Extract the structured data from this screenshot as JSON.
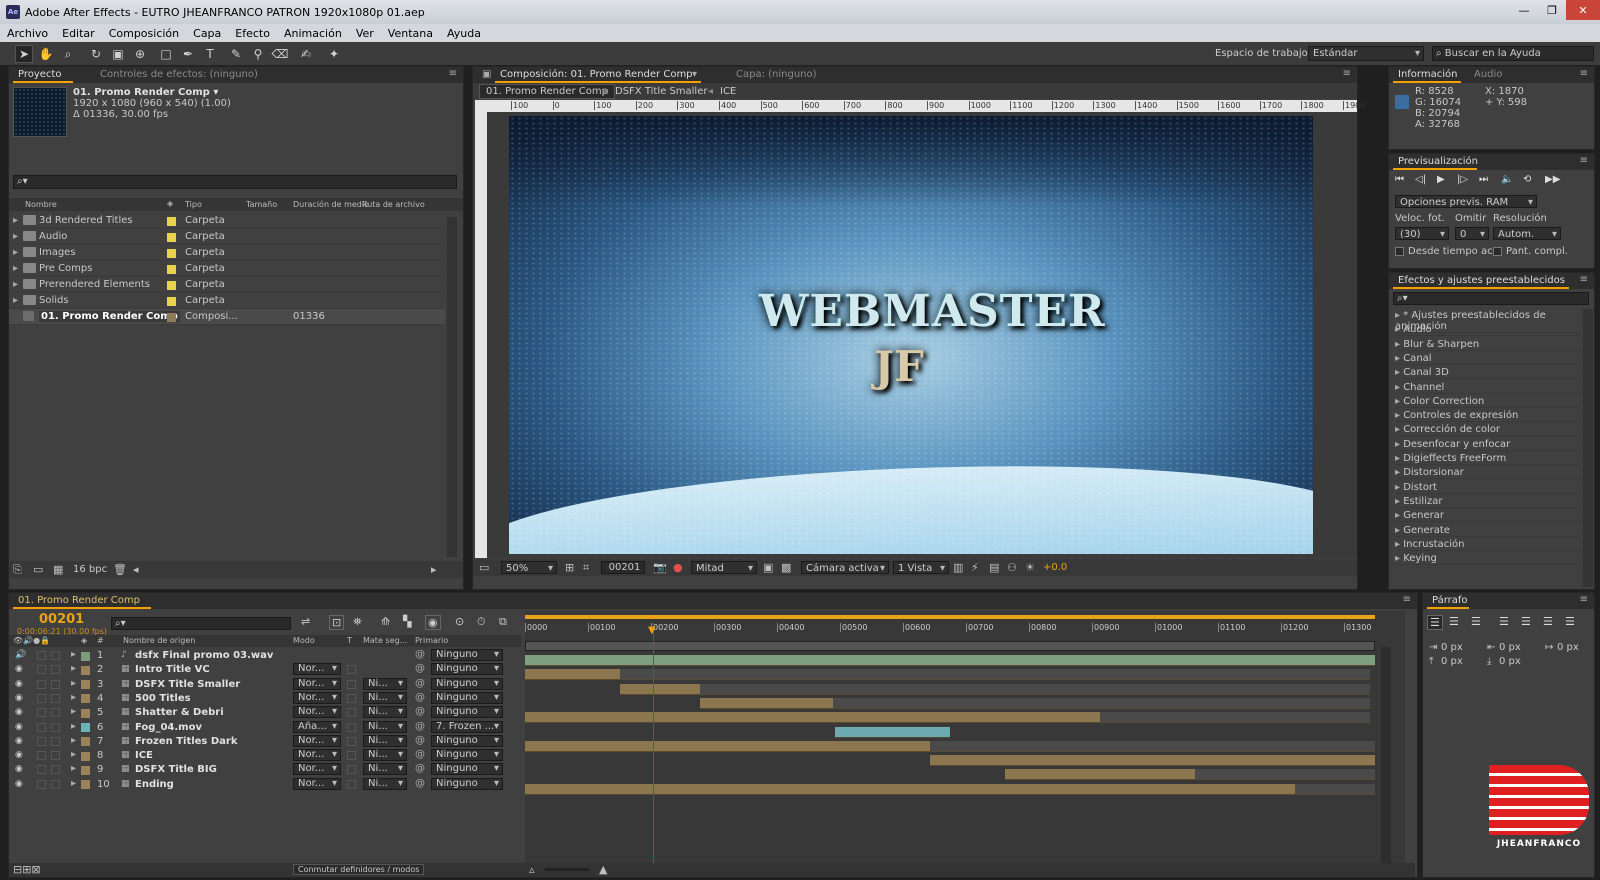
{
  "window": {
    "title": "Adobe After Effects - EUTRO JHEANFRANCO PATRON 1920x1080p 01.aep",
    "app_icon": "Ae"
  },
  "menu": [
    "Archivo",
    "Editar",
    "Composición",
    "Capa",
    "Efecto",
    "Animación",
    "Ver",
    "Ventana",
    "Ayuda"
  ],
  "toolbar": {
    "workspace_label": "Espacio de trabajo:",
    "workspace_value": "Estándar",
    "help_placeholder": "Buscar en la Ayuda"
  },
  "project": {
    "tab": "Proyecto",
    "tab2": "Controles de efectos: (ninguno)",
    "comp_name": "01. Promo Render Comp ▾",
    "comp_res": "1920 x 1080  (960 x 540) (1.00)",
    "comp_dur": "Δ 01336, 30.00 fps",
    "columns": [
      "Nombre",
      "Tipo",
      "Tamaño",
      "Duración de medio",
      "Ruta de archivo"
    ],
    "items": [
      {
        "name": "3d Rendered Titles",
        "type": "Carpeta",
        "dur": ""
      },
      {
        "name": "Audio",
        "type": "Carpeta",
        "dur": ""
      },
      {
        "name": "Images",
        "type": "Carpeta",
        "dur": ""
      },
      {
        "name": "Pre Comps",
        "type": "Carpeta",
        "dur": ""
      },
      {
        "name": "Prerendered Elements",
        "type": "Carpeta",
        "dur": ""
      },
      {
        "name": "Solids",
        "type": "Carpeta",
        "dur": ""
      },
      {
        "name": "01. Promo Render Comp",
        "type": "Composi...",
        "dur": "01336"
      }
    ],
    "bpc": "16 bpc"
  },
  "comp": {
    "tab": "Composición: 01. Promo Render Comp",
    "tab2": "Capa: (ninguno)",
    "crumbs": [
      "01. Promo Render Comp",
      "DSFX Title Smaller",
      "ICE"
    ],
    "ruler": [
      "100",
      "0",
      "100",
      "200",
      "300",
      "400",
      "500",
      "600",
      "700",
      "800",
      "900",
      "1000",
      "1100",
      "1200",
      "1300",
      "1400",
      "1500",
      "1600",
      "1700",
      "1800",
      "1900"
    ],
    "title_line1": "WEBMASTER",
    "title_line2": "JF",
    "zoom": "50%",
    "frame": "00201",
    "resolution": "Mitad",
    "camera": "Cámara activa",
    "views": "1 Vista",
    "exposure": "+0.0"
  },
  "info": {
    "tab": "Información",
    "tab2": "Audio",
    "r": "R:  8528",
    "g": "G:  16074",
    "b": "B:  20794",
    "a": "A:  32768",
    "x": "X:  1870",
    "y": "+ Y:  598",
    "swatch": "#3a6ea0"
  },
  "preview": {
    "tab": "Previsualización",
    "options": "Opciones previs. RAM",
    "fps_label": "Veloc. fot.",
    "skip_label": "Omitir",
    "res_label": "Resolución",
    "fps": "(30)",
    "skip": "0",
    "res": "Autom.",
    "from_current": "Desde tiempo act.",
    "full_screen": "Pant. compl."
  },
  "effects": {
    "tab": "Efectos y ajustes preestablecidos",
    "items": [
      "* Ajustes preestablecidos de animación",
      "Audio",
      "Blur & Sharpen",
      "Canal",
      "Canal 3D",
      "Channel",
      "Color Correction",
      "Controles de expresión",
      "Corrección de color",
      "Desenfocar y enfocar",
      "Digieffects FreeForm",
      "Distorsionar",
      "Distort",
      "Estilizar",
      "Generar",
      "Generate",
      "Incrustación",
      "Keying"
    ]
  },
  "timeline": {
    "tab": "01. Promo Render Comp",
    "time": "00201",
    "time_sub": "0:00:06:21 (30.00 fps)",
    "col_num": "#",
    "col_name": "Nombre de origen",
    "col_mode": "Modo",
    "col_t": "T",
    "col_mate": "Mate seg...",
    "col_parent": "Primario",
    "ruler": [
      "0000",
      "00100",
      "00200",
      "00300",
      "00400",
      "00500",
      "00600",
      "00700",
      "00800",
      "00900",
      "01000",
      "01100",
      "01200",
      "01300"
    ],
    "footer": "Conmutar definidores / modos",
    "layers": [
      {
        "n": "1",
        "name": "dsfx Final promo 03.wav",
        "mode": "",
        "mate": "",
        "parent": "Ninguno",
        "audio": true
      },
      {
        "n": "2",
        "name": "Intro Title VC",
        "mode": "Nor...",
        "mate": "",
        "parent": "Ninguno"
      },
      {
        "n": "3",
        "name": "DSFX Title Smaller",
        "mode": "Nor...",
        "mate": "Ni...",
        "parent": "Ninguno"
      },
      {
        "n": "4",
        "name": "500 Titles",
        "mode": "Nor...",
        "mate": "Ni...",
        "parent": "Ninguno"
      },
      {
        "n": "5",
        "name": "Shatter & Debri",
        "mode": "Nor...",
        "mate": "Ni...",
        "parent": "Ninguno"
      },
      {
        "n": "6",
        "name": "Fog_04.mov",
        "mode": "Aña...",
        "mate": "Ni...",
        "parent": "7. Frozen ..."
      },
      {
        "n": "7",
        "name": "Frozen Titles Dark",
        "mode": "Nor...",
        "mate": "Ni...",
        "parent": "Ninguno"
      },
      {
        "n": "8",
        "name": "ICE",
        "mode": "Nor...",
        "mate": "Ni...",
        "parent": "Ninguno"
      },
      {
        "n": "9",
        "name": "DSFX Title BIG",
        "mode": "Nor...",
        "mate": "Ni...",
        "parent": "Ninguno"
      },
      {
        "n": "10",
        "name": "Ending",
        "mode": "Nor...",
        "mate": "Ni...",
        "parent": "Ninguno"
      }
    ]
  },
  "paragraph": {
    "tab": "Párrafo",
    "px1": "0 px",
    "px2": "0 px",
    "px3": "0 px",
    "px4": "0 px",
    "px5": "0 px"
  },
  "watermark": {
    "text": "JHEANFRANCO"
  }
}
